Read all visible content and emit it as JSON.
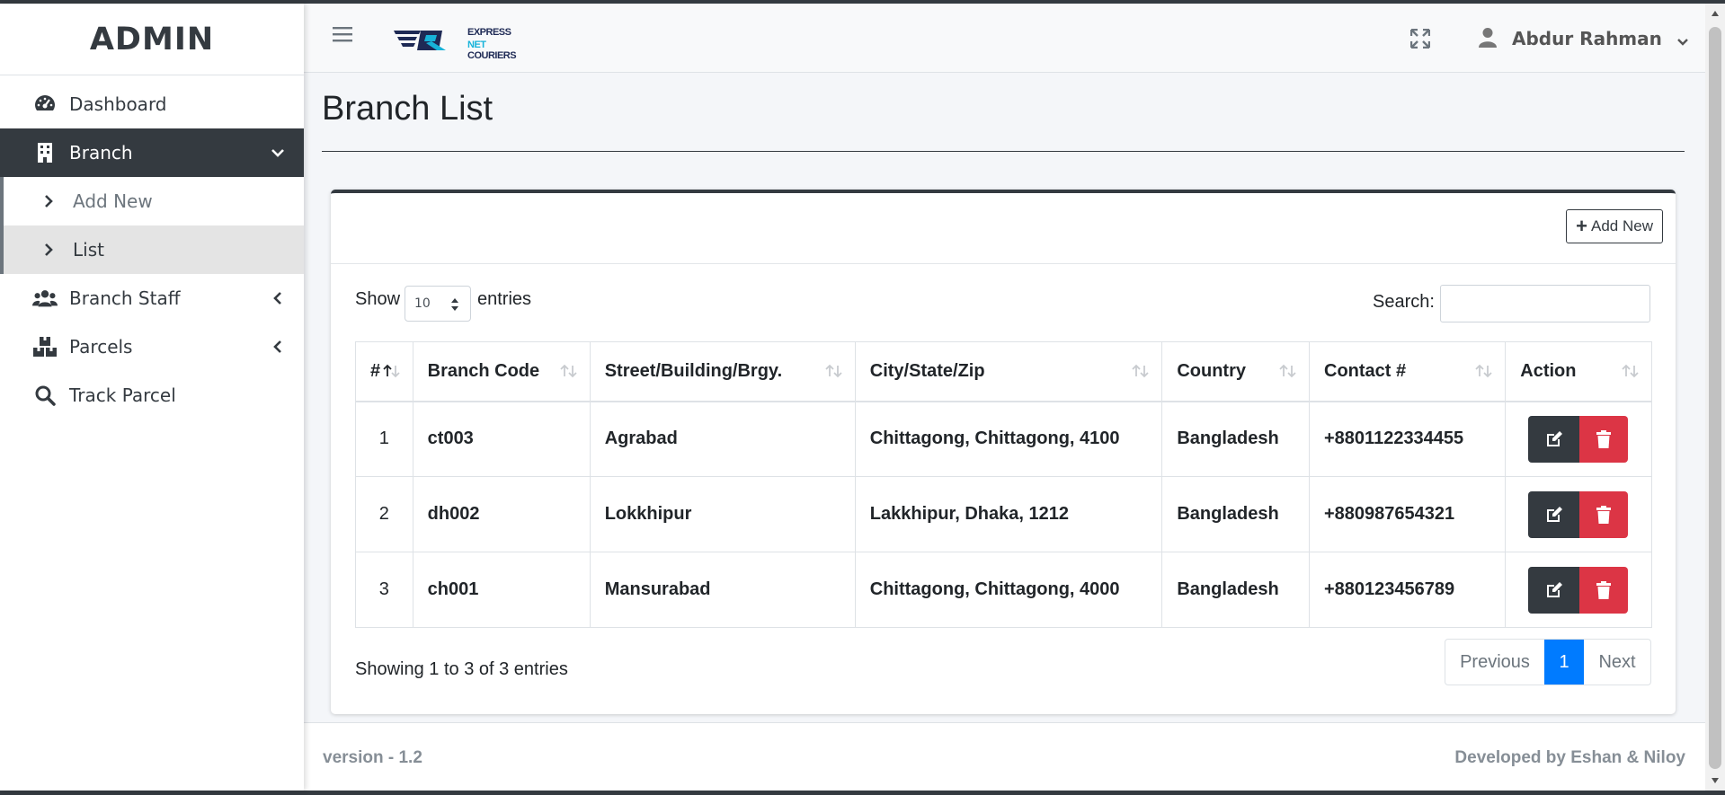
{
  "sidebar": {
    "brand": "ADMIN",
    "items": [
      {
        "label": "Dashboard",
        "icon": "tachometer-icon"
      },
      {
        "label": "Branch",
        "icon": "building-icon"
      },
      {
        "label": "Add New",
        "icon": "chevron-right-icon"
      },
      {
        "label": "List",
        "icon": "chevron-right-icon"
      },
      {
        "label": "Branch Staff",
        "icon": "users-icon"
      },
      {
        "label": "Parcels",
        "icon": "boxes-icon"
      },
      {
        "label": "Track Parcel",
        "icon": "search-icon"
      }
    ]
  },
  "header": {
    "logo_line1": "EXPRESS",
    "logo_line2_a": "NET",
    "logo_line2_b": "COURIERS",
    "user_name": "Abdur Rahman"
  },
  "main": {
    "page_title": "Branch List",
    "add_new_label": "Add New",
    "show_label": "Show",
    "entries_value": "10",
    "entries_label": "entries",
    "search_label": "Search:",
    "columns": [
      "#",
      "Branch Code",
      "Street/Building/Brgy.",
      "City/State/Zip",
      "Country",
      "Contact #",
      "Action"
    ],
    "rows": [
      {
        "num": "1",
        "code": "ct003",
        "street": "Agrabad",
        "city": "Chittagong, Chittagong, 4100",
        "country": "Bangladesh",
        "contact": "+8801122334455"
      },
      {
        "num": "2",
        "code": "dh002",
        "street": "Lokkhipur",
        "city": "Lakkhipur, Dhaka, 1212",
        "country": "Bangladesh",
        "contact": "+880987654321"
      },
      {
        "num": "3",
        "code": "ch001",
        "street": "Mansurabad",
        "city": "Chittagong, Chittagong, 4000",
        "country": "Bangladesh",
        "contact": "+880123456789"
      }
    ],
    "info": "Showing 1 to 3 of 3 entries",
    "pager": {
      "prev": "Previous",
      "current": "1",
      "next": "Next"
    }
  },
  "footer": {
    "version": "version - 1.2",
    "developer": "Developed by Eshan & Niloy"
  },
  "colors": {
    "dark": "#343a40",
    "danger": "#dc3545",
    "primary": "#007bff",
    "accent_logo": "#17b3d9"
  }
}
